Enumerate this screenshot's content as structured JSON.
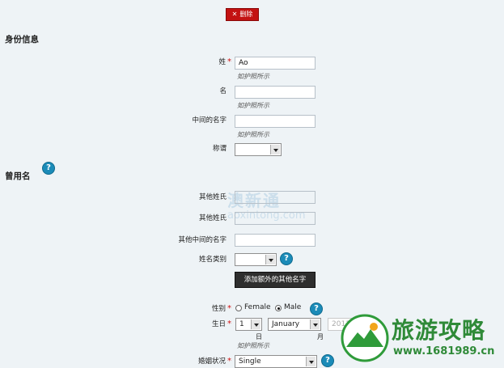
{
  "delete_button": {
    "icon": "✕",
    "label": "删除"
  },
  "section_identity": {
    "title": "身份信息"
  },
  "last_name": {
    "label": "姓",
    "required": "*",
    "value": "Ao",
    "hint": "如护照所示"
  },
  "first_name": {
    "label": "名",
    "value": "",
    "hint": "如护照所示"
  },
  "middle_name": {
    "label": "中间的名字",
    "value": "",
    "hint": "如护照所示"
  },
  "title_field": {
    "label": "称谓",
    "value": ""
  },
  "section_alias": {
    "title": "曾用名"
  },
  "other_last_name": {
    "label": "其他姓氏",
    "value": ""
  },
  "other_last_name2": {
    "label": "其他姓氏",
    "value": ""
  },
  "other_middle_name": {
    "label": "其他中间的名字",
    "value": ""
  },
  "name_type": {
    "label": "姓名类别",
    "value": ""
  },
  "add_name_button": {
    "label": "添加额外的其他名字"
  },
  "gender": {
    "label": "性别",
    "required": "*",
    "female": "Female",
    "male": "Male",
    "selected": "Male"
  },
  "birthday": {
    "label": "生日",
    "required": "*",
    "day": "1",
    "month": "January",
    "year": "2011",
    "day_caption": "日",
    "month_caption": "月",
    "hint": "如护照所示"
  },
  "marital_status": {
    "label": "婚姻状况",
    "required": "*",
    "value": "Single"
  },
  "help_icon": {
    "glyph": "?"
  },
  "watermark": {
    "text1": "澳新通",
    "text2": "aoxintong.com"
  },
  "site_logo": {
    "name": "旅游攻略",
    "url": "www.1681989.cn"
  },
  "colors": {
    "accent": "#cc1111",
    "help": "#1b8bb8",
    "page_bg": "#eef3f6"
  }
}
